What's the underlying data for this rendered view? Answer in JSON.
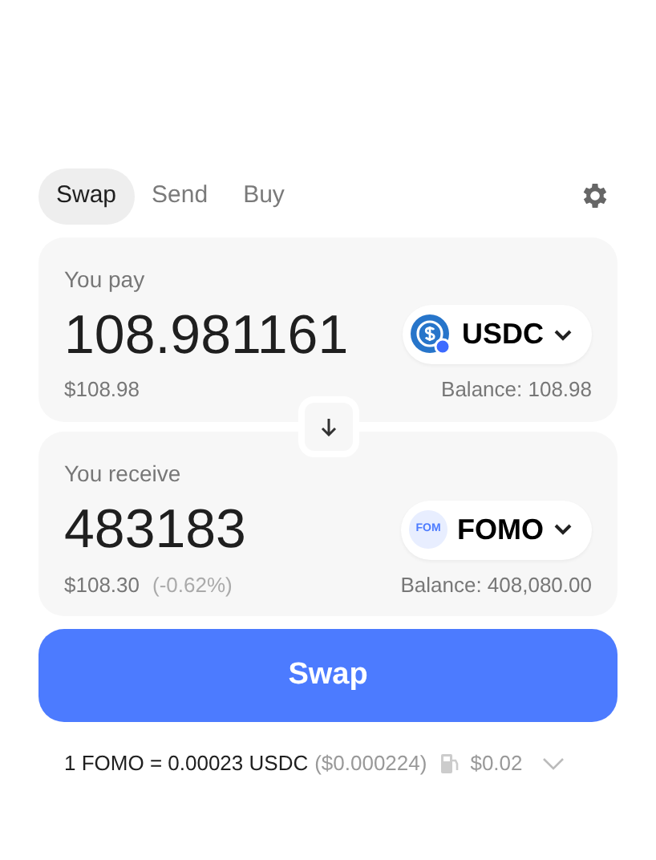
{
  "tabs": [
    {
      "label": "Swap",
      "selected": true
    },
    {
      "label": "Send",
      "selected": false
    },
    {
      "label": "Buy",
      "selected": false
    }
  ],
  "panels": [
    {
      "label": "You pay",
      "amount": "108.981161",
      "token": {
        "symbol": "USDC",
        "kind": "usdc"
      },
      "usd_value": "$108.98",
      "balance": "Balance: 108.98"
    },
    {
      "label": "You receive",
      "amount": "483183",
      "token": {
        "symbol": "FOMO",
        "kind": "text",
        "icon_text": "FOM"
      },
      "usd_value": "$108.30",
      "price_impact": "(-0.62%)",
      "balance": "Balance: 408,080.00"
    }
  ],
  "swap_button": "Swap",
  "footer": {
    "rate": "1 FOMO = 0.00023 USDC",
    "rate_usd": "($0.000224)",
    "gas": "$0.02",
    "expanded": false
  }
}
